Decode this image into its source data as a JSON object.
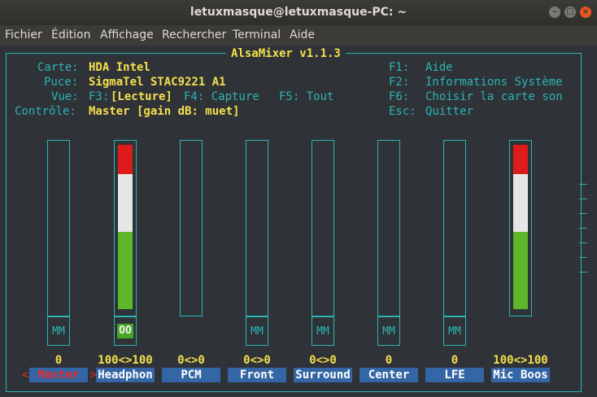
{
  "window": {
    "title": "letuxmasque@letuxmasque-PC: ~",
    "minimize_icon": "minimize-icon",
    "maximize_icon": "maximize-icon",
    "close_icon": "close-icon"
  },
  "menubar": [
    "Fichier",
    "Édition",
    "Affichage",
    "Rechercher",
    "Terminal",
    "Aide"
  ],
  "alsamixer": {
    "title": "AlsaMixer v1.1.3",
    "info": {
      "carte_label": "Carte:",
      "carte_value": "HDA Intel",
      "puce_label": "Puce:",
      "puce_value": "SigmaTel STAC9221 A1",
      "vue_label": "Vue:",
      "vue_f3_key": "F3:",
      "vue_f3_value": "[Lecture]",
      "vue_f4": "F4: Capture",
      "vue_f5": "F5: Tout",
      "controle_label": "Contrôle:",
      "controle_value": "Master [gain dB: muet]"
    },
    "keys": [
      {
        "key": "F1:",
        "label": "Aide"
      },
      {
        "key": "F2:",
        "label": "Informations Système"
      },
      {
        "key": "F6:",
        "label": "Choisir la carte son"
      },
      {
        "key": "Esc:",
        "label": "Quitter"
      }
    ],
    "channels": [
      {
        "name": "Master",
        "value": "0",
        "mute": "MM",
        "level_percent": 0,
        "selected": true
      },
      {
        "name": "Headphon",
        "value": "100<>100",
        "mute": "OO",
        "level_percent": 100,
        "selected": false
      },
      {
        "name": "PCM",
        "value": "0<>0",
        "mute": "",
        "level_percent": 0,
        "selected": false
      },
      {
        "name": "Front",
        "value": "0<>0",
        "mute": "MM",
        "level_percent": 0,
        "selected": false
      },
      {
        "name": "Surround",
        "value": "0<>0",
        "mute": "MM",
        "level_percent": 0,
        "selected": false
      },
      {
        "name": "Center",
        "value": "0",
        "mute": "MM",
        "level_percent": 0,
        "selected": false
      },
      {
        "name": "LFE",
        "value": "0",
        "mute": "MM",
        "level_percent": 0,
        "selected": false
      },
      {
        "name": "Mic Boos",
        "value": "100<>100",
        "mute": "",
        "level_percent": 100,
        "selected": false
      }
    ],
    "selection_arrows": {
      "left": "<",
      "right": ">"
    },
    "colors": {
      "frame": "#2bb5b5",
      "highlight": "#f4e04d",
      "green": "#5cb82a",
      "white": "#e6e6e6",
      "red": "#de1b1b",
      "label_bg": "#3465a4"
    }
  }
}
